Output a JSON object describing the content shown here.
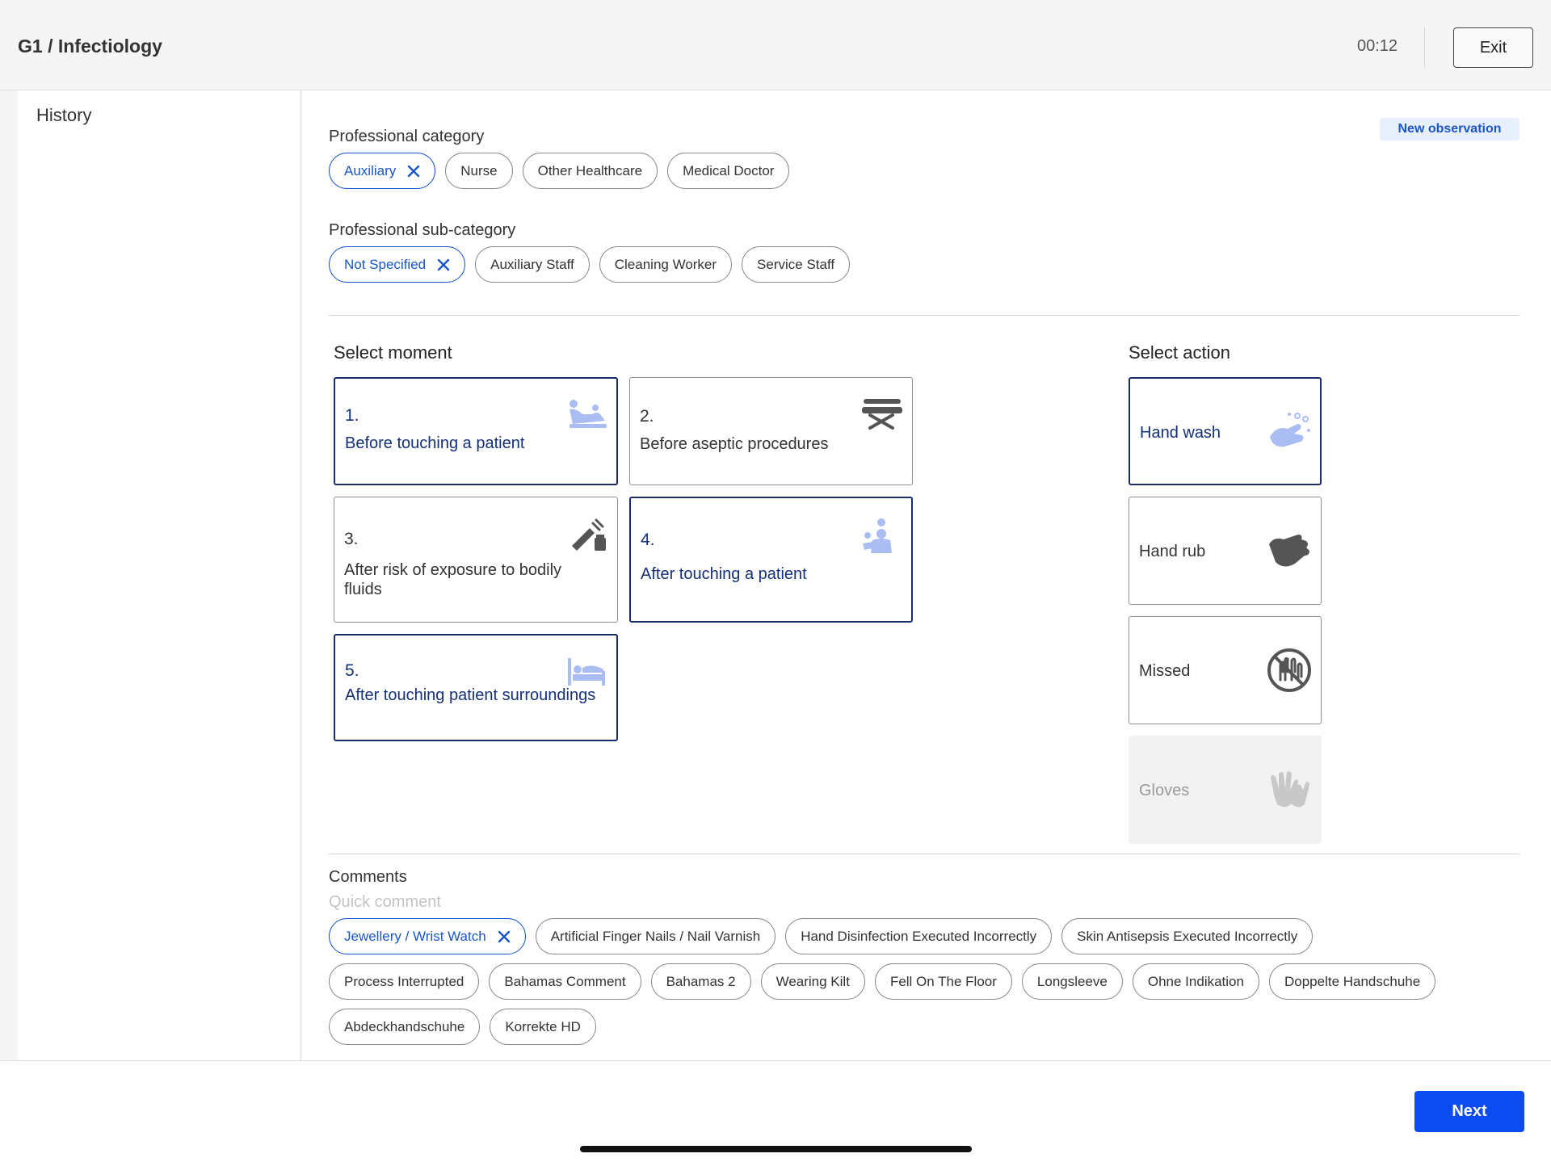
{
  "header": {
    "title": "G1 / Infectiology",
    "timer": "00:12",
    "exit_label": "Exit"
  },
  "sidebar": {
    "history_label": "History"
  },
  "badge": "New observation",
  "professional_category": {
    "label": "Professional category",
    "chips": [
      {
        "label": "Auxiliary",
        "selected": true
      },
      {
        "label": "Nurse",
        "selected": false
      },
      {
        "label": "Other Healthcare",
        "selected": false
      },
      {
        "label": "Medical Doctor",
        "selected": false
      }
    ]
  },
  "professional_subcategory": {
    "label": "Professional sub-category",
    "chips": [
      {
        "label": "Not Specified",
        "selected": true
      },
      {
        "label": "Auxiliary Staff",
        "selected": false
      },
      {
        "label": "Cleaning Worker",
        "selected": false
      },
      {
        "label": "Service Staff",
        "selected": false
      }
    ]
  },
  "moments": {
    "label": "Select moment",
    "items": [
      {
        "num": "1.",
        "label": "Before touching a patient",
        "selected": true,
        "icon": "patient-touch-icon"
      },
      {
        "num": "2.",
        "label": "Before aseptic procedures",
        "selected": false,
        "icon": "aseptic-procedure-icon"
      },
      {
        "num": "3.",
        "label": "After risk of exposure to bodily fluids",
        "selected": false,
        "icon": "syringe-fluids-icon"
      },
      {
        "num": "4.",
        "label": "After touching a patient",
        "selected": true,
        "icon": "doctor-patient-icon"
      },
      {
        "num": "5.",
        "label": "After touching patient surroundings",
        "selected": true,
        "icon": "hospital-bed-icon"
      }
    ]
  },
  "actions": {
    "label": "Select action",
    "items": [
      {
        "label": "Hand wash",
        "selected": true,
        "disabled": false,
        "icon": "hand-wash-icon"
      },
      {
        "label": "Hand rub",
        "selected": false,
        "disabled": false,
        "icon": "hand-rub-icon"
      },
      {
        "label": "Missed",
        "selected": false,
        "disabled": false,
        "icon": "missed-icon"
      },
      {
        "label": "Gloves",
        "selected": false,
        "disabled": true,
        "icon": "gloves-icon"
      }
    ]
  },
  "comments": {
    "label": "Comments",
    "placeholder": "Quick comment",
    "row1": [
      {
        "label": "Jewellery / Wrist Watch",
        "selected": true
      },
      {
        "label": "Artificial Finger Nails / Nail Varnish",
        "selected": false
      },
      {
        "label": "Hand Disinfection Executed Incorrectly",
        "selected": false
      },
      {
        "label": "Skin Antisepsis Executed Incorrectly",
        "selected": false
      }
    ],
    "row2": [
      {
        "label": "Process Interrupted",
        "selected": false
      },
      {
        "label": "Bahamas Comment",
        "selected": false
      },
      {
        "label": "Bahamas 2",
        "selected": false
      },
      {
        "label": "Wearing Kilt",
        "selected": false
      },
      {
        "label": "Fell On The Floor",
        "selected": false
      },
      {
        "label": "Longsleeve",
        "selected": false
      },
      {
        "label": "Ohne Indikation",
        "selected": false
      },
      {
        "label": "Doppelte Handschuhe",
        "selected": false
      }
    ],
    "row3": [
      {
        "label": "Abdeckhandschuhe",
        "selected": false
      },
      {
        "label": "Korrekte HD",
        "selected": false
      }
    ]
  },
  "footer": {
    "next_label": "Next"
  },
  "colors": {
    "accent": "#1a56c8",
    "selected_border": "#1b2c6b",
    "next_button": "#0a4cf0",
    "icon_light": "#a9bdf2",
    "icon_dark": "#555555"
  }
}
